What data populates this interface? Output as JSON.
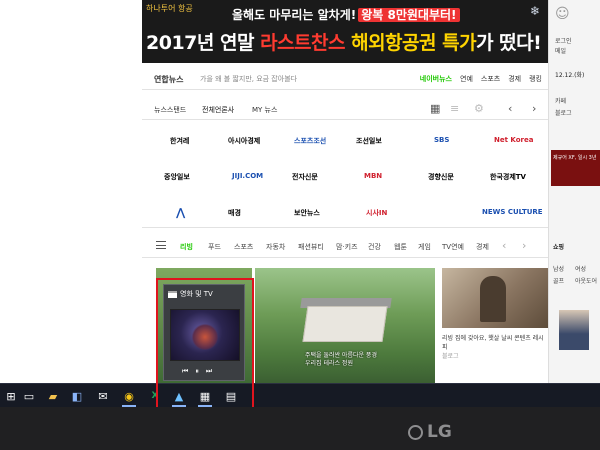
{
  "banner": {
    "brand": "하나투어 항공",
    "line1_pre": "올해도 마무리는 알차게!",
    "line1_highlight": "왕복 8만원대부터!",
    "line2_a": "2017년 연말",
    "line2_b": "라스트찬스",
    "line2_c": "해외항공권 특가",
    "line2_d": "가 떴다!"
  },
  "searchbar": {
    "label": "연합뉴스",
    "placeholder": "가을 왜 볼 짧지만, 요금 잡아볼다",
    "links": [
      "네이버뉴스",
      "연예",
      "스포츠",
      "경제",
      "랭킹"
    ]
  },
  "newsstand": {
    "label": "뉴스스탠드",
    "tab_all": "전체언론사",
    "tab_my": "MY 뉴스"
  },
  "logos": [
    {
      "text": "한겨레",
      "color": "#333333"
    },
    {
      "text": "아시아경제",
      "color": "#333333"
    },
    {
      "text": "스포츠조선",
      "color": "#1a4fb0"
    },
    {
      "text": "조선일보",
      "color": "#333333"
    },
    {
      "text": "SBS",
      "color": "#1a4fb0"
    },
    {
      "text": "Net Korea",
      "color": "#d0202e"
    },
    {
      "text": "중앙일보",
      "color": "#333333"
    },
    {
      "text": "JIJI.COM",
      "color": "#1a4fb0"
    },
    {
      "text": "전자신문",
      "color": "#333333"
    },
    {
      "text": "MBN",
      "color": "#d0202e"
    },
    {
      "text": "경향신문",
      "color": "#333333"
    },
    {
      "text": "한국경제TV",
      "color": "#333333"
    },
    {
      "text": "매경",
      "color": "#333333"
    },
    {
      "text": "보안뉴스",
      "color": "#333333"
    },
    {
      "text": "시사IN",
      "color": "#d0202e"
    },
    {
      "text": "NEWS CULTURE",
      "color": "#1a4fb0"
    }
  ],
  "tabs": [
    "리빙",
    "푸드",
    "스포츠",
    "자동차",
    "패션뷰티",
    "맘·키즈",
    "건강",
    "웹툰",
    "게임",
    "TV연예",
    "경제"
  ],
  "content": {
    "photo2_caption": "주택을 둘러싼 아름다운 풍경",
    "photo2_caption2": "우리집 테라스 정원",
    "photo3_caption": "리빙 집에 갖아요, 햇살 날씨 콘텐츠 레시피",
    "photo3_source": "블로그"
  },
  "rightcol": {
    "date": "12.12.(화)",
    "items": [
      "로그인",
      "메일",
      "카페",
      "블로그",
      "쇼핑"
    ],
    "ad_text": "제규어 XF, 일시 3년",
    "shopping": "쇼핑",
    "shopping_items": [
      "남성",
      "여성",
      "골프",
      "아웃도어"
    ]
  },
  "popup": {
    "title": "영화 및 TV"
  },
  "taskbar": {
    "icons": [
      "windows-start-icon",
      "task-view-icon",
      "file-explorer-icon",
      "store-icon",
      "mail-icon",
      "chrome-icon",
      "excel-icon",
      "photos-icon",
      "movies-tv-icon",
      "calculator-icon"
    ]
  },
  "bezel": {
    "brand": "LG"
  }
}
